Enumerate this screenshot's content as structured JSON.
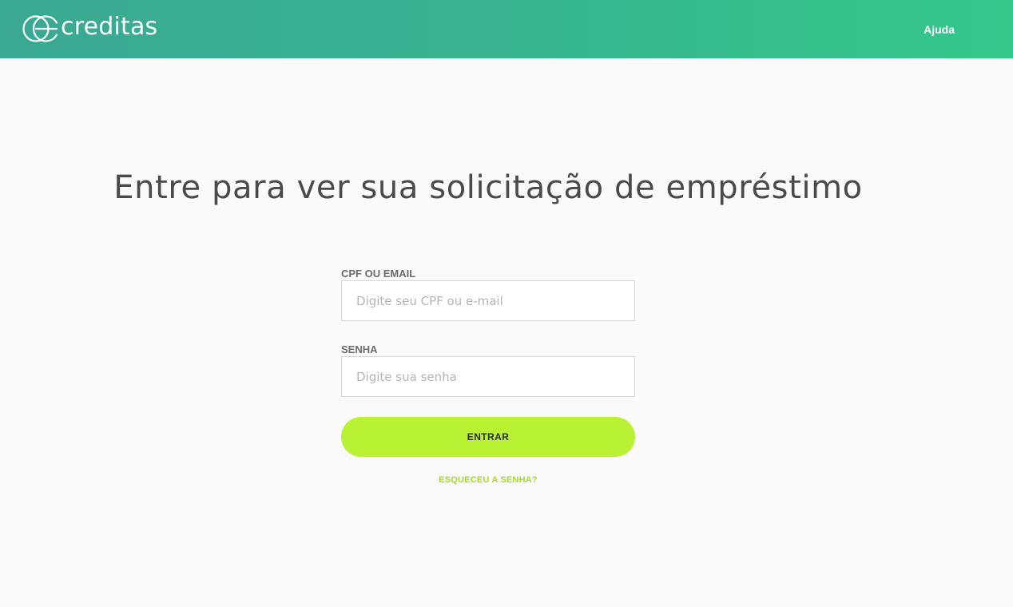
{
  "header": {
    "brand_name": "creditas",
    "help_label": "Ajuda",
    "gradient_start": "#3aa893",
    "gradient_end": "#34c78a"
  },
  "main": {
    "title": "Entre para ver sua solicitação de empréstimo"
  },
  "form": {
    "login_label": "CPF OU EMAIL",
    "login_placeholder": "Digite seu CPF ou e-mail",
    "login_value": "",
    "password_label": "SENHA",
    "password_placeholder": "Digite sua senha",
    "password_value": "",
    "submit_label": "ENTRAR",
    "forgot_label": "ESQUECEU A SENHA?"
  },
  "colors": {
    "accent": "#b8f233",
    "link": "#a6d92e",
    "text": "#4a4a4a"
  },
  "icons": {
    "logo": "creditas-logo-icon"
  }
}
